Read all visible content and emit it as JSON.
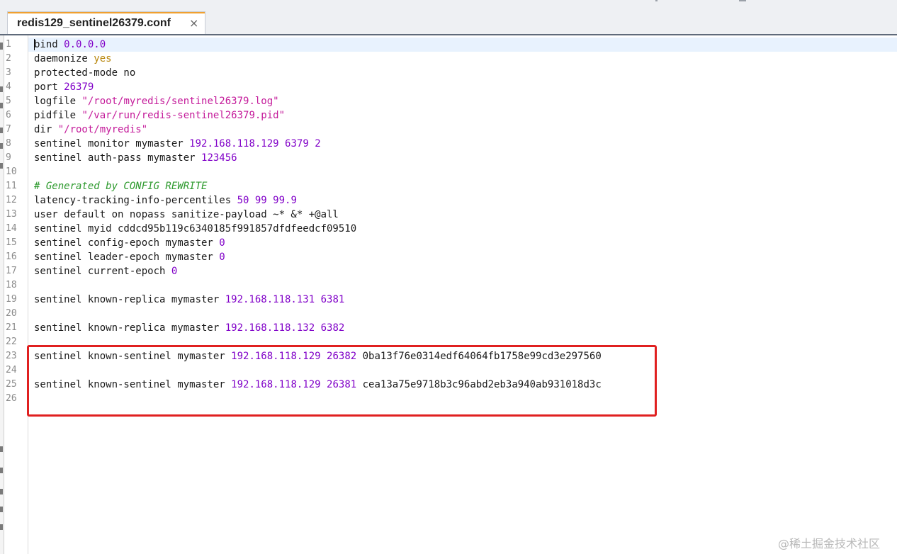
{
  "tab": {
    "title": "redis129_sentinel26379.conf",
    "close_glyph": "×"
  },
  "editor": {
    "line_numbers": [
      "1",
      "2",
      "3",
      "4",
      "5",
      "6",
      "7",
      "8",
      "9",
      "10",
      "11",
      "12",
      "13",
      "14",
      "15",
      "16",
      "17",
      "18",
      "19",
      "20",
      "21",
      "22",
      "23",
      "24",
      "25",
      "26"
    ],
    "lines": [
      [
        [
          "w",
          "bind "
        ],
        [
          "n",
          "0.0.0.0"
        ]
      ],
      [
        [
          "w",
          "daemonize "
        ],
        [
          "y",
          "yes"
        ]
      ],
      [
        [
          "w",
          "protected-mode no"
        ]
      ],
      [
        [
          "w",
          "port "
        ],
        [
          "n",
          "26379"
        ]
      ],
      [
        [
          "w",
          "logfile "
        ],
        [
          "s",
          "\"/root/myredis/sentinel26379.log\""
        ]
      ],
      [
        [
          "w",
          "pidfile "
        ],
        [
          "s",
          "\"/var/run/redis-sentinel26379.pid\""
        ]
      ],
      [
        [
          "w",
          "dir "
        ],
        [
          "s",
          "\"/root/myredis\""
        ]
      ],
      [
        [
          "w",
          "sentinel monitor mymaster "
        ],
        [
          "n",
          "192.168.118.129"
        ],
        [
          "w",
          " "
        ],
        [
          "n",
          "6379"
        ],
        [
          "w",
          " "
        ],
        [
          "n",
          "2"
        ]
      ],
      [
        [
          "w",
          "sentinel auth-pass mymaster "
        ],
        [
          "n",
          "123456"
        ]
      ],
      [],
      [
        [
          "c",
          "# Generated by CONFIG REWRITE"
        ]
      ],
      [
        [
          "w",
          "latency-tracking-info-percentiles "
        ],
        [
          "n",
          "50"
        ],
        [
          "w",
          " "
        ],
        [
          "n",
          "99"
        ],
        [
          "w",
          " "
        ],
        [
          "n",
          "99.9"
        ]
      ],
      [
        [
          "w",
          "user default on nopass sanitize-payload ~* &* +@all"
        ]
      ],
      [
        [
          "w",
          "sentinel myid cddcd95b119c6340185f991857dfdfeedcf09510"
        ]
      ],
      [
        [
          "w",
          "sentinel config-epoch mymaster "
        ],
        [
          "n",
          "0"
        ]
      ],
      [
        [
          "w",
          "sentinel leader-epoch mymaster "
        ],
        [
          "n",
          "0"
        ]
      ],
      [
        [
          "w",
          "sentinel current-epoch "
        ],
        [
          "n",
          "0"
        ]
      ],
      [],
      [
        [
          "w",
          "sentinel known-replica mymaster "
        ],
        [
          "n",
          "192.168.118.131"
        ],
        [
          "w",
          " "
        ],
        [
          "n",
          "6381"
        ]
      ],
      [],
      [
        [
          "w",
          "sentinel known-replica mymaster "
        ],
        [
          "n",
          "192.168.118.132"
        ],
        [
          "w",
          " "
        ],
        [
          "n",
          "6382"
        ]
      ],
      [],
      [
        [
          "w",
          "sentinel known-sentinel mymaster "
        ],
        [
          "n",
          "192.168.118.129"
        ],
        [
          "w",
          " "
        ],
        [
          "n",
          "26382"
        ],
        [
          "w",
          " 0ba13f76e0314edf64064fb1758e99cd3e297560"
        ]
      ],
      [],
      [
        [
          "w",
          "sentinel known-sentinel mymaster "
        ],
        [
          "n",
          "192.168.118.129"
        ],
        [
          "w",
          " "
        ],
        [
          "n",
          "26381"
        ],
        [
          "w",
          " cea13a75e9718b3c96abd2eb3a940ab931018d3c"
        ]
      ],
      []
    ],
    "highlight_color": "#e02020",
    "token_colors": {
      "plain": "#1a1a1a",
      "number": "#8000c8",
      "string": "#c41a9a",
      "keyword": "#b8860b",
      "comment": "#2e9a2e"
    }
  },
  "watermark": "@稀土掘金技术社区"
}
